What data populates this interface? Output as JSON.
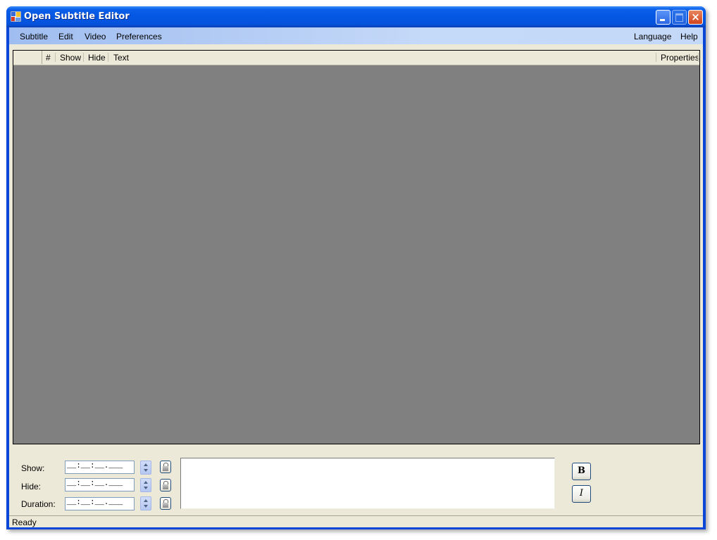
{
  "window": {
    "title": "Open Subtitle Editor",
    "controls": {
      "minimize": "minimize",
      "maximize": "maximize",
      "close": "×"
    }
  },
  "menubar": {
    "left": [
      "Subtitle",
      "Edit",
      "Video",
      "Preferences"
    ],
    "right": [
      "Language",
      "Help"
    ]
  },
  "grid": {
    "columns": [
      "#",
      "Show",
      "Hide",
      "Text"
    ],
    "right_column": "Properties",
    "rows": []
  },
  "editor": {
    "show_label": "Show:",
    "hide_label": "Hide:",
    "duration_label": "Duration:",
    "show_value": "__:__:__.___",
    "hide_value": "__:__:__.___",
    "duration_value": "__:__:__.___",
    "text_value": "",
    "bold_label": "B",
    "italic_label": "I"
  },
  "status": {
    "text": "Ready"
  }
}
